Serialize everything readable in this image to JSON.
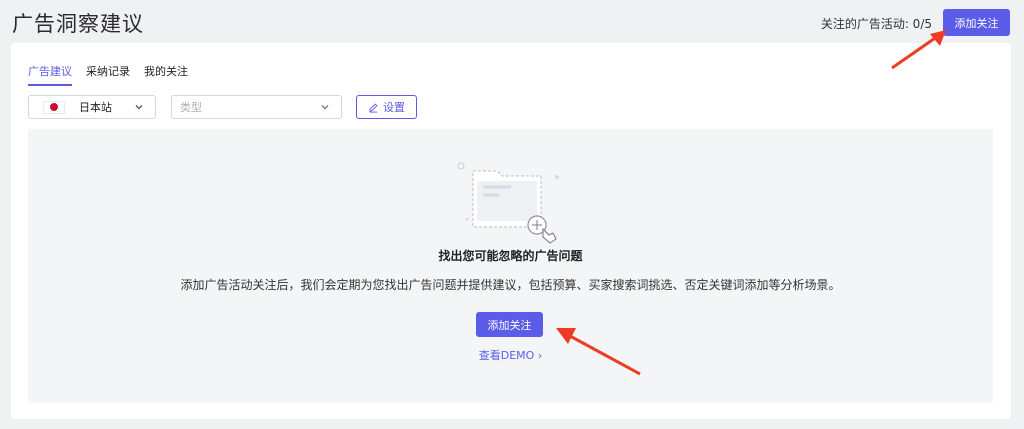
{
  "header": {
    "title": "广告洞察建议",
    "follow_status": "关注的广告活动: 0/5",
    "add_button": "添加关注"
  },
  "tabs": [
    {
      "label": "广告建议",
      "active": true
    },
    {
      "label": "采纳记录",
      "active": false
    },
    {
      "label": "我的关注",
      "active": false
    }
  ],
  "filters": {
    "site_value": "日本站",
    "site_flag": "japan-flag-icon",
    "type_placeholder": "类型",
    "settings_label": "设置"
  },
  "empty_state": {
    "title": "找出您可能忽略的广告问题",
    "description": "添加广告活动关注后，我们会定期为您找出广告问题并提供建议，包括预算、买家搜索词挑选、否定关键词添加等分析场景。",
    "add_button": "添加关注",
    "demo_link": "查看DEMO ›"
  },
  "colors": {
    "accent": "#5b5ce8",
    "annotation_arrow": "#ef3b24",
    "background": "#f0f1f3"
  }
}
